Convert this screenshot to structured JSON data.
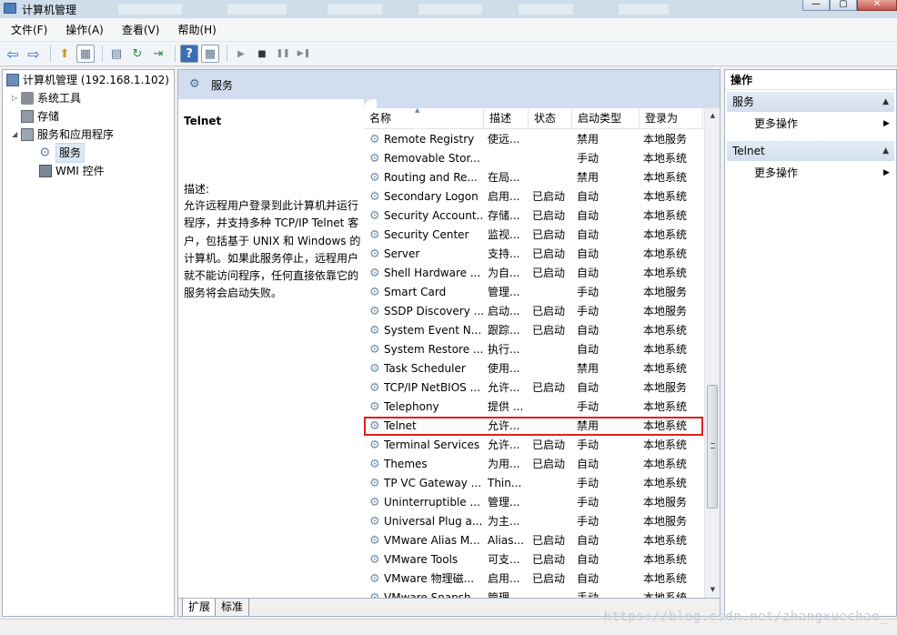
{
  "window": {
    "title": "计算机管理",
    "btn_min": "—",
    "btn_max": "▢",
    "btn_close": "✕"
  },
  "menu": [
    "文件(F)",
    "操作(A)",
    "查看(V)",
    "帮助(H)"
  ],
  "toolbar": {
    "icons": [
      "back-arrow-icon",
      "forward-arrow-icon",
      "up-folder-icon",
      "show-hide-tree-icon",
      "properties-icon",
      "refresh-icon",
      "export-list-icon",
      "help-icon",
      "show-hide-action-pane-icon",
      "play-icon",
      "stop-icon",
      "pause-icon",
      "resume-icon"
    ],
    "glyphs": [
      "⇦",
      "⇨",
      "⬆",
      "▦",
      "▤",
      "↻",
      "⇥",
      "?",
      "▦",
      "▶",
      "■",
      "❚❚",
      "▶❚"
    ]
  },
  "tree": {
    "root": "计算机管理 (192.168.1.102)",
    "items": [
      {
        "label": "系统工具",
        "level": 1,
        "expander": "▷"
      },
      {
        "label": "存储",
        "level": 1,
        "expander": ""
      },
      {
        "label": "服务和应用程序",
        "level": 1,
        "expander": "◢"
      },
      {
        "label": "服务",
        "level": 2,
        "expander": "",
        "selected": true
      },
      {
        "label": "WMI 控件",
        "level": 2,
        "expander": ""
      }
    ]
  },
  "center": {
    "header": "服务",
    "selected_service": "Telnet",
    "description_label": "描述:",
    "description": "允许远程用户登录到此计算机并运行程序，并支持多种 TCP/IP Telnet 客户，包括基于 UNIX 和 Windows 的计算机。如果此服务停止，远程用户就不能访问程序，任何直接依靠它的服务将会启动失败。",
    "columns": [
      "名称",
      "描述",
      "状态",
      "启动类型",
      "登录为"
    ],
    "rows": [
      [
        "Remote Registry",
        "使远...",
        "",
        "禁用",
        "本地服务"
      ],
      [
        "Removable Stor...",
        "",
        "",
        "手动",
        "本地系统"
      ],
      [
        "Routing and Re...",
        "在局...",
        "",
        "禁用",
        "本地系统"
      ],
      [
        "Secondary Logon",
        "启用...",
        "已启动",
        "自动",
        "本地系统"
      ],
      [
        "Security Account...",
        "存储...",
        "已启动",
        "自动",
        "本地系统"
      ],
      [
        "Security Center",
        "监视...",
        "已启动",
        "自动",
        "本地系统"
      ],
      [
        "Server",
        "支持...",
        "已启动",
        "自动",
        "本地系统"
      ],
      [
        "Shell Hardware ...",
        "为自...",
        "已启动",
        "自动",
        "本地系统"
      ],
      [
        "Smart Card",
        "管理...",
        "",
        "手动",
        "本地服务"
      ],
      [
        "SSDP Discovery ...",
        "启动...",
        "已启动",
        "手动",
        "本地服务"
      ],
      [
        "System Event N...",
        "跟踪...",
        "已启动",
        "自动",
        "本地系统"
      ],
      [
        "System Restore ...",
        "执行...",
        "",
        "自动",
        "本地系统"
      ],
      [
        "Task Scheduler",
        "使用...",
        "",
        "禁用",
        "本地系统"
      ],
      [
        "TCP/IP NetBIOS ...",
        "允许...",
        "已启动",
        "自动",
        "本地服务"
      ],
      [
        "Telephony",
        "提供 ...",
        "",
        "手动",
        "本地系统"
      ],
      [
        "Telnet",
        "允许...",
        "",
        "禁用",
        "本地系统"
      ],
      [
        "Terminal Services",
        "允许...",
        "已启动",
        "手动",
        "本地系统"
      ],
      [
        "Themes",
        "为用...",
        "已启动",
        "自动",
        "本地系统"
      ],
      [
        "TP VC Gateway ...",
        "Thin...",
        "",
        "手动",
        "本地系统"
      ],
      [
        "Uninterruptible ...",
        "管理...",
        "",
        "手动",
        "本地服务"
      ],
      [
        "Universal Plug a...",
        "为主...",
        "",
        "手动",
        "本地服务"
      ],
      [
        "VMware Alias M...",
        "Alias...",
        "已启动",
        "自动",
        "本地系统"
      ],
      [
        "VMware Tools",
        "可支...",
        "已启动",
        "自动",
        "本地系统"
      ],
      [
        "VMware 物理磁...",
        "启用...",
        "已启动",
        "自动",
        "本地系统"
      ],
      [
        "VMware Snapsh...",
        "管理...",
        "",
        "手动",
        "本地系统"
      ]
    ],
    "highlight_index": 15,
    "tabs": [
      "扩展",
      "标准"
    ]
  },
  "actions": {
    "title": "操作",
    "sections": [
      {
        "name": "服务",
        "action": "更多操作"
      },
      {
        "name": "Telnet",
        "action": "更多操作"
      }
    ]
  },
  "watermark": "https://blog.csdn.net/zhangxuechao_"
}
